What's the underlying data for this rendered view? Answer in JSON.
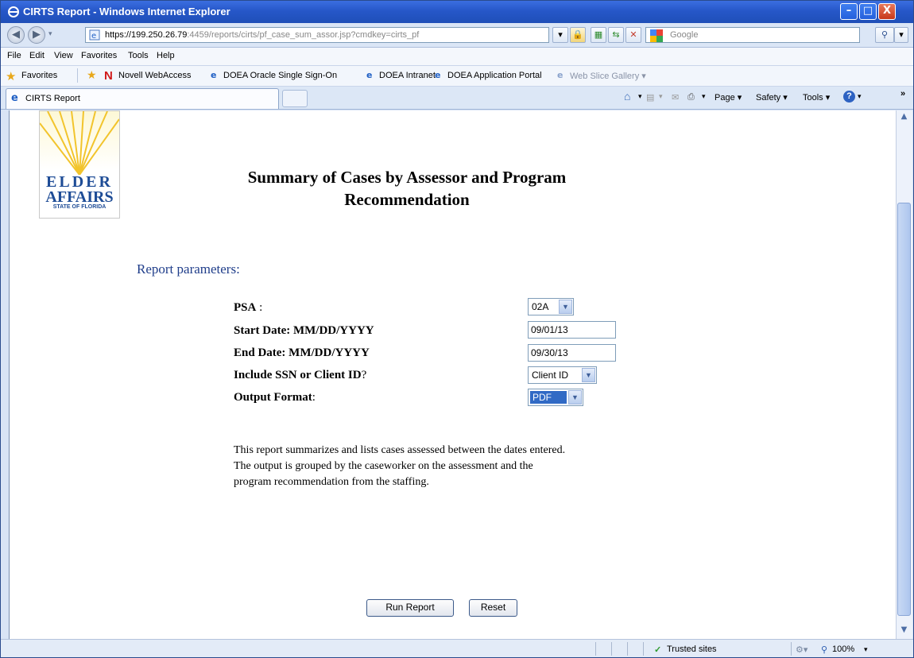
{
  "window": {
    "title": "CIRTS Report - Windows Internet Explorer",
    "min_label": "–",
    "max_label": "□",
    "close_label": "X"
  },
  "address_bar": {
    "url_main": "https://199.250.26.79",
    "url_rest": ":4459/reports/cirts/pf_case_sum_assor.jsp?cmdkey=cirts_pf",
    "search_placeholder": "Google"
  },
  "menu": [
    "File",
    "Edit",
    "View",
    "Favorites",
    "Tools",
    "Help"
  ],
  "favorites_bar": {
    "favorites_label": "Favorites",
    "items": [
      "Novell WebAccess",
      "DOEA Oracle Single Sign-On",
      "DOEA Intranet",
      "DOEA Application Portal",
      "Web Slice Gallery ▾"
    ]
  },
  "tab": {
    "label": "CIRTS Report"
  },
  "command_bar": {
    "page": "Page ▾",
    "safety": "Safety ▾",
    "tools": "Tools ▾",
    "more": "»"
  },
  "logo": {
    "line1": "ELDER",
    "line2": "AFFAIRS",
    "line3": "STATE OF FLORIDA"
  },
  "page": {
    "title_line1": "Summary of Cases by Assessor and Program",
    "title_line2": "Recommendation",
    "params_heading": "Report parameters:"
  },
  "form": {
    "psa_label": "PSA",
    "psa_suffix": " :",
    "psa_value": "02A",
    "start_label": "Start Date: MM/DD/YYYY",
    "start_value": "09/01/13",
    "end_label": "End Date: MM/DD/YYYY",
    "end_value": "09/30/13",
    "ssn_label": "Include SSN or Client ID",
    "ssn_suffix": "?",
    "ssn_value": "Client ID",
    "format_label": "Output Format",
    "format_suffix": ":",
    "format_value": "PDF"
  },
  "description": [
    "This report summarizes and lists cases assessed between the dates entered.",
    "The output is grouped by the caseworker on the assessment and the",
    "program recommendation from the staffing."
  ],
  "buttons": {
    "run": "Run Report",
    "reset": "Reset"
  },
  "status_bar": {
    "zone": "Trusted sites",
    "zoom": "100%"
  }
}
